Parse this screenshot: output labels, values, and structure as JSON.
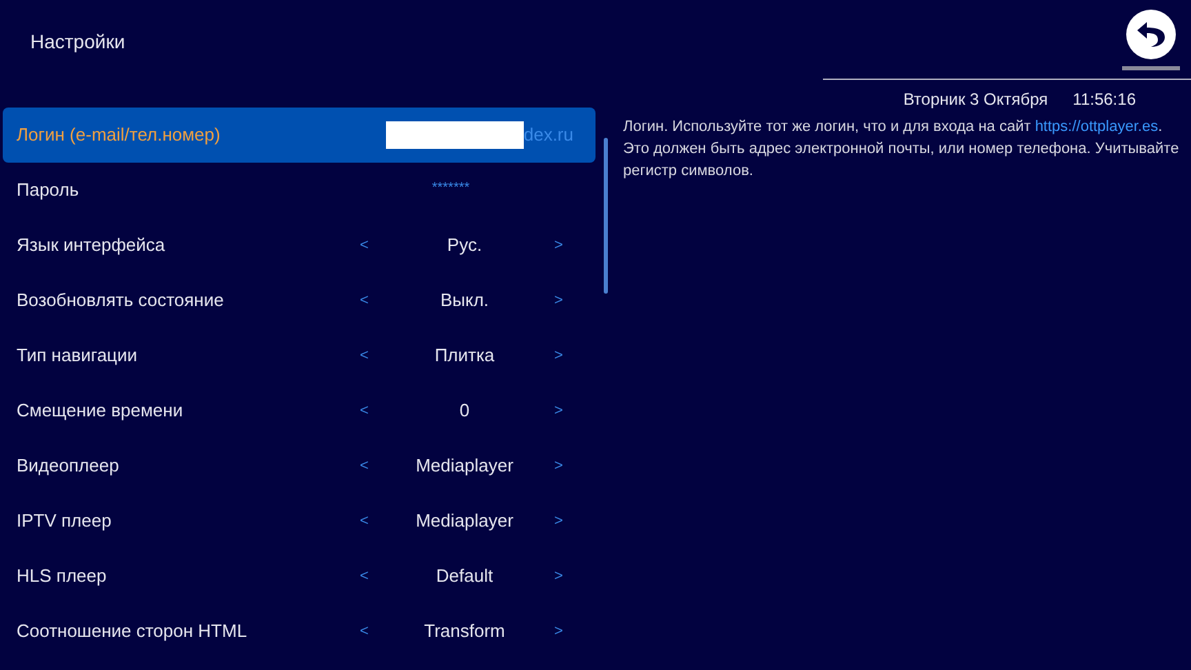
{
  "header": {
    "title": "Настройки"
  },
  "status": {
    "date": "Вторник 3 Октября",
    "time": "11:56:16"
  },
  "help": {
    "text_before": "Логин. Используйте тот же логин, что и для входа на сайт ",
    "link": "https://ottplayer.es",
    "text_after": ". Это должен быть адрес электронной почты, или номер телефона. Учитывайте регистр символов."
  },
  "settings": [
    {
      "kind": "text",
      "label": "Логин (e-mail/тел.номер)",
      "value": "dex.ru",
      "selected": true
    },
    {
      "kind": "password",
      "label": "Пароль",
      "value": "*******",
      "selected": false
    },
    {
      "kind": "choice",
      "label": "Язык интерфейса",
      "value": "Рус.",
      "prev": "<",
      "next": ">",
      "selected": false
    },
    {
      "kind": "choice",
      "label": "Возобновлять состояние",
      "value": "Выкл.",
      "prev": "<",
      "next": ">",
      "selected": false
    },
    {
      "kind": "choice",
      "label": "Тип навигации",
      "value": "Плитка",
      "prev": "<",
      "next": ">",
      "selected": false
    },
    {
      "kind": "choice",
      "label": "Смещение времени",
      "value": "0",
      "prev": "<",
      "next": ">",
      "selected": false
    },
    {
      "kind": "choice",
      "label": "Видеоплеер",
      "value": "Mediaplayer",
      "prev": "<",
      "next": ">",
      "selected": false
    },
    {
      "kind": "choice",
      "label": "IPTV плеер",
      "value": "Mediaplayer",
      "prev": "<",
      "next": ">",
      "selected": false
    },
    {
      "kind": "choice",
      "label": "HLS плеер",
      "value": "Default",
      "prev": "<",
      "next": ">",
      "selected": false
    },
    {
      "kind": "choice",
      "label": "Соотношение сторон HTML",
      "value": "Transform",
      "prev": "<",
      "next": ">",
      "selected": false
    }
  ]
}
